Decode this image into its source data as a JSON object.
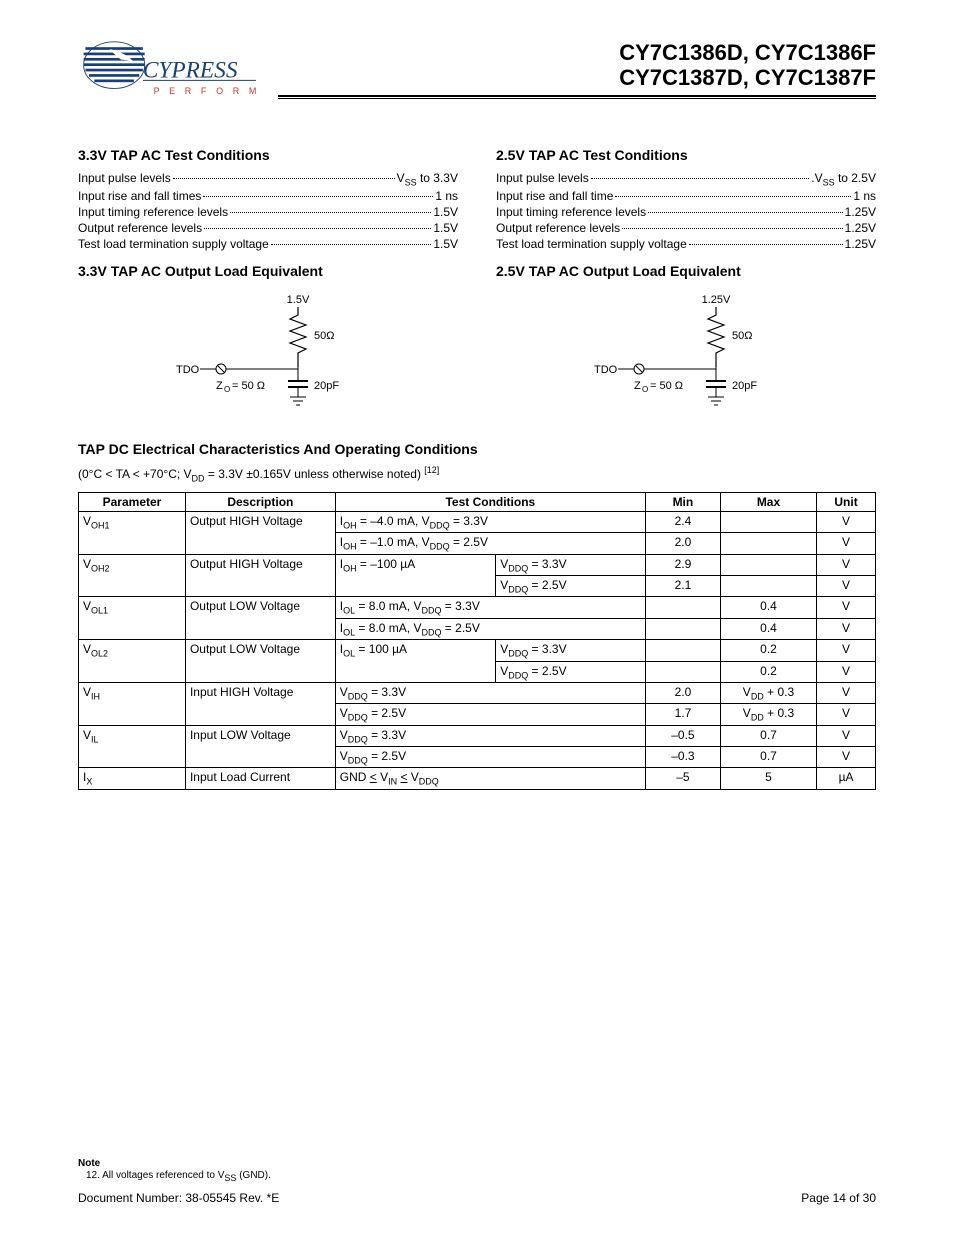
{
  "header": {
    "logo_name": "CYPRESS",
    "logo_tag": "P E R F O R M",
    "part_line1": "CY7C1386D, CY7C1386F",
    "part_line2": "CY7C1387D, CY7C1387F"
  },
  "left": {
    "title1": "3.3V TAP AC Test Conditions",
    "rows": [
      {
        "label_html": "Input pulse levels",
        "value_html": "V<span class=\"subv\">SS</span> to 3.3V"
      },
      {
        "label_html": "Input rise and fall times",
        "value_html": "1 ns"
      },
      {
        "label_html": "Input timing reference levels",
        "value_html": "1.5V"
      },
      {
        "label_html": "Output reference levels",
        "value_html": "1.5V"
      },
      {
        "label_html": "Test load termination supply voltage",
        "value_html": "1.5V"
      }
    ],
    "title2": "3.3V TAP AC Output Load Equivalent",
    "circuit": {
      "top_v": "1.5V",
      "r": "50Ω",
      "c": "20pF",
      "sig": "TDO",
      "zo": "Z<tspan baseline-shift=\"sub\" font-size=\"8\">O</tspan>= 50 Ω"
    }
  },
  "right": {
    "title1": "2.5V TAP AC Test Conditions",
    "rows": [
      {
        "label_html": "Input pulse levels",
        "value_html": ".V<span class=\"subv\">SS</span> to 2.5V"
      },
      {
        "label_html": "Input rise and fall time",
        "value_html": "1 ns"
      },
      {
        "label_html": "Input timing reference levels",
        "value_html": "1.25V"
      },
      {
        "label_html": "Output reference levels",
        "value_html": "1.25V"
      },
      {
        "label_html": "Test load termination supply voltage",
        "value_html": "1.25V"
      }
    ],
    "title2": "2.5V TAP AC Output Load Equivalent",
    "circuit": {
      "top_v": "1.25V",
      "r": "50Ω",
      "c": "20pF",
      "sig": "TDO",
      "zo": "Z<tspan baseline-shift=\"sub\" font-size=\"8\">O</tspan>= 50 Ω"
    }
  },
  "dc": {
    "title": "TAP DC Electrical Characteristics And Operating Conditions",
    "note_html": "(0°C &lt; TA &lt; +70°C; V<span class=\"subv\">DD</span> = 3.3V ±0.165V unless otherwise noted) <span class=\"sup\">[12]</span>",
    "headers": [
      "Parameter",
      "Description",
      "Test Conditions",
      "Min",
      "Max",
      "Unit"
    ],
    "rows": [
      {
        "param_html": "V<span class=\"subv\">OH1</span>",
        "param_rows": 2,
        "desc": "Output HIGH Voltage",
        "desc_rows": 2,
        "cond_html": "I<span class=\"subv\">OH</span> = –4.0 mA, V<span class=\"subv\">DDQ</span> = 3.3V",
        "cond_cols": 2,
        "min": "2.4",
        "max": "",
        "unit": "V"
      },
      {
        "cond_html": "I<span class=\"subv\">OH</span> = –1.0 mA, V<span class=\"subv\">DDQ</span> = 2.5V",
        "cond_cols": 2,
        "min": "2.0",
        "max": "",
        "unit": "V"
      },
      {
        "param_html": "V<span class=\"subv\">OH2</span>",
        "param_rows": 2,
        "desc": "Output HIGH Voltage",
        "desc_rows": 2,
        "cond_html": "I<span class=\"subv\">OH</span> = –100 µA",
        "cond_rows": 2,
        "cond2_html": "V<span class=\"subv\">DDQ</span> = 3.3V",
        "min": "2.9",
        "max": "",
        "unit": "V"
      },
      {
        "cond2_html": "V<span class=\"subv\">DDQ</span> = 2.5V",
        "min": "2.1",
        "max": "",
        "unit": "V"
      },
      {
        "param_html": "V<span class=\"subv\">OL1</span>",
        "param_rows": 2,
        "desc": "Output LOW Voltage",
        "desc_rows": 2,
        "cond_html": "I<span class=\"subv\">OL</span> = 8.0 mA, V<span class=\"subv\">DDQ</span> = 3.3V",
        "cond_cols": 2,
        "min": "",
        "max": "0.4",
        "unit": "V"
      },
      {
        "cond_html": "I<span class=\"subv\">OL</span> = 8.0 mA, V<span class=\"subv\">DDQ</span> = 2.5V",
        "cond_cols": 2,
        "min": "",
        "max": "0.4",
        "unit": "V"
      },
      {
        "param_html": "V<span class=\"subv\">OL2</span>",
        "param_rows": 2,
        "desc": "Output LOW Voltage",
        "desc_rows": 2,
        "cond_html": "I<span class=\"subv\">OL</span> = 100 µA",
        "cond_rows": 2,
        "cond2_html": "V<span class=\"subv\">DDQ</span> = 3.3V",
        "min": "",
        "max": "0.2",
        "unit": "V"
      },
      {
        "cond2_html": "V<span class=\"subv\">DDQ</span> = 2.5V",
        "min": "",
        "max": "0.2",
        "unit": "V"
      },
      {
        "param_html": "V<span class=\"subv\">IH</span>",
        "param_rows": 2,
        "desc": "Input HIGH Voltage",
        "desc_rows": 2,
        "cond_html": "V<span class=\"subv\">DDQ</span> = 3.3V",
        "cond_cols": 2,
        "min": "2.0",
        "max_html": "V<span class=\"subv\">DD</span> + 0.3",
        "unit": "V"
      },
      {
        "cond_html": "V<span class=\"subv\">DDQ</span> = 2.5V",
        "cond_cols": 2,
        "min": "1.7",
        "max_html": "V<span class=\"subv\">DD</span> + 0.3",
        "unit": "V"
      },
      {
        "param_html": "V<span class=\"subv\">IL</span>",
        "param_rows": 2,
        "desc": "Input LOW Voltage",
        "desc_rows": 2,
        "cond_html": "V<span class=\"subv\">DDQ</span> = 3.3V",
        "cond_cols": 2,
        "min": "–0.5",
        "max": "0.7",
        "unit": "V"
      },
      {
        "cond_html": "V<span class=\"subv\">DDQ</span> = 2.5V",
        "cond_cols": 2,
        "min": "–0.3",
        "max": "0.7",
        "unit": "V"
      },
      {
        "param_html": "I<span class=\"subv\">X</span>",
        "desc": "Input Load Current",
        "cond_html": "GND <span style=\"text-decoration:underline\">&lt;</span> V<span class=\"subv\">IN</span> <span style=\"text-decoration:underline\">&lt;</span> V<span class=\"subv\">DDQ</span>",
        "cond_cols": 2,
        "min": "–5",
        "max": "5",
        "unit": "µA"
      }
    ]
  },
  "footer": {
    "note_heading": "Note",
    "note_text_html": "12. All voltages referenced to V<span class=\"subv\">SS</span> (GND).",
    "doc": "Document Number: 38-05545 Rev. *E",
    "page": "Page 14 of 30"
  }
}
